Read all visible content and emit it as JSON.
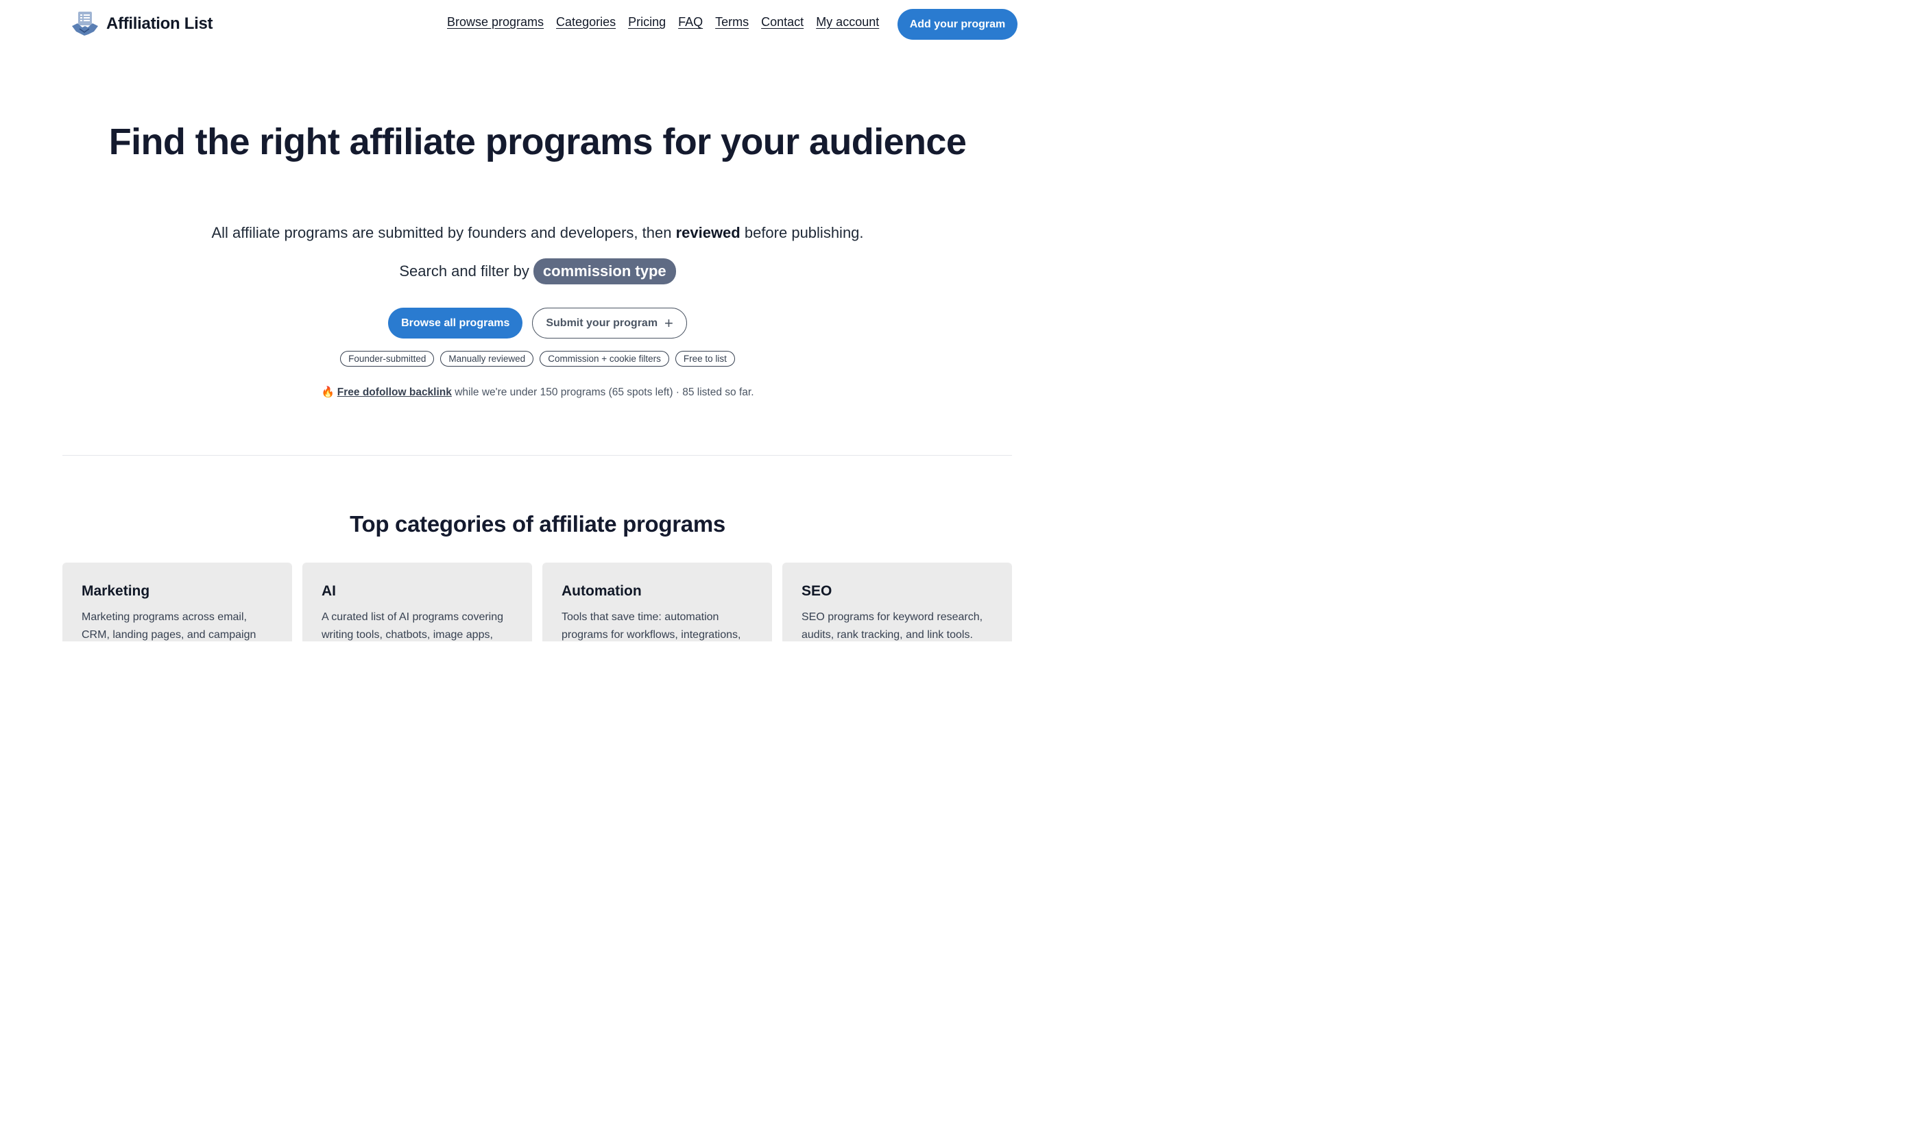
{
  "brand": {
    "name": "Affiliation List"
  },
  "nav": [
    {
      "label": "Browse programs"
    },
    {
      "label": "Categories"
    },
    {
      "label": "Pricing"
    },
    {
      "label": "FAQ"
    },
    {
      "label": "Terms"
    },
    {
      "label": "Contact"
    },
    {
      "label": "My account"
    }
  ],
  "header_cta": "Add your program",
  "hero": {
    "title": "Find the right affiliate programs for your audience",
    "sub_before": "All affiliate programs are submitted by founders and developers, then ",
    "sub_bold": "reviewed",
    "sub_after": " before publishing.",
    "filter_prefix": "Search and filter by",
    "filter_pill": "commission type",
    "primary_button": "Browse all programs",
    "secondary_button": "Submit your program",
    "tags": [
      "Founder-submitted",
      "Manually reviewed",
      "Commission + cookie filters",
      "Free to list"
    ],
    "promo_link": "Free dofollow backlink",
    "promo_text": " while we're under 150 programs (65 spots left) · 85 listed so far."
  },
  "categories": {
    "title": "Top categories of affiliate programs",
    "items": [
      {
        "name": "Marketing",
        "desc": "Marketing programs across email, CRM, landing pages, and campaign"
      },
      {
        "name": "AI",
        "desc": "A curated list of AI programs covering writing tools, chatbots, image apps,"
      },
      {
        "name": "Automation",
        "desc": "Tools that save time: automation programs for workflows, integrations,"
      },
      {
        "name": "SEO",
        "desc": "SEO programs for keyword research, audits, rank tracking, and link tools."
      }
    ]
  },
  "colors": {
    "accent": "#2a7bd0",
    "pill": "#5f6b84",
    "card": "#ebebeb"
  },
  "icons": {
    "logo": "handshake-checklist-icon",
    "fire": "fire-icon",
    "plus": "plus-icon"
  }
}
